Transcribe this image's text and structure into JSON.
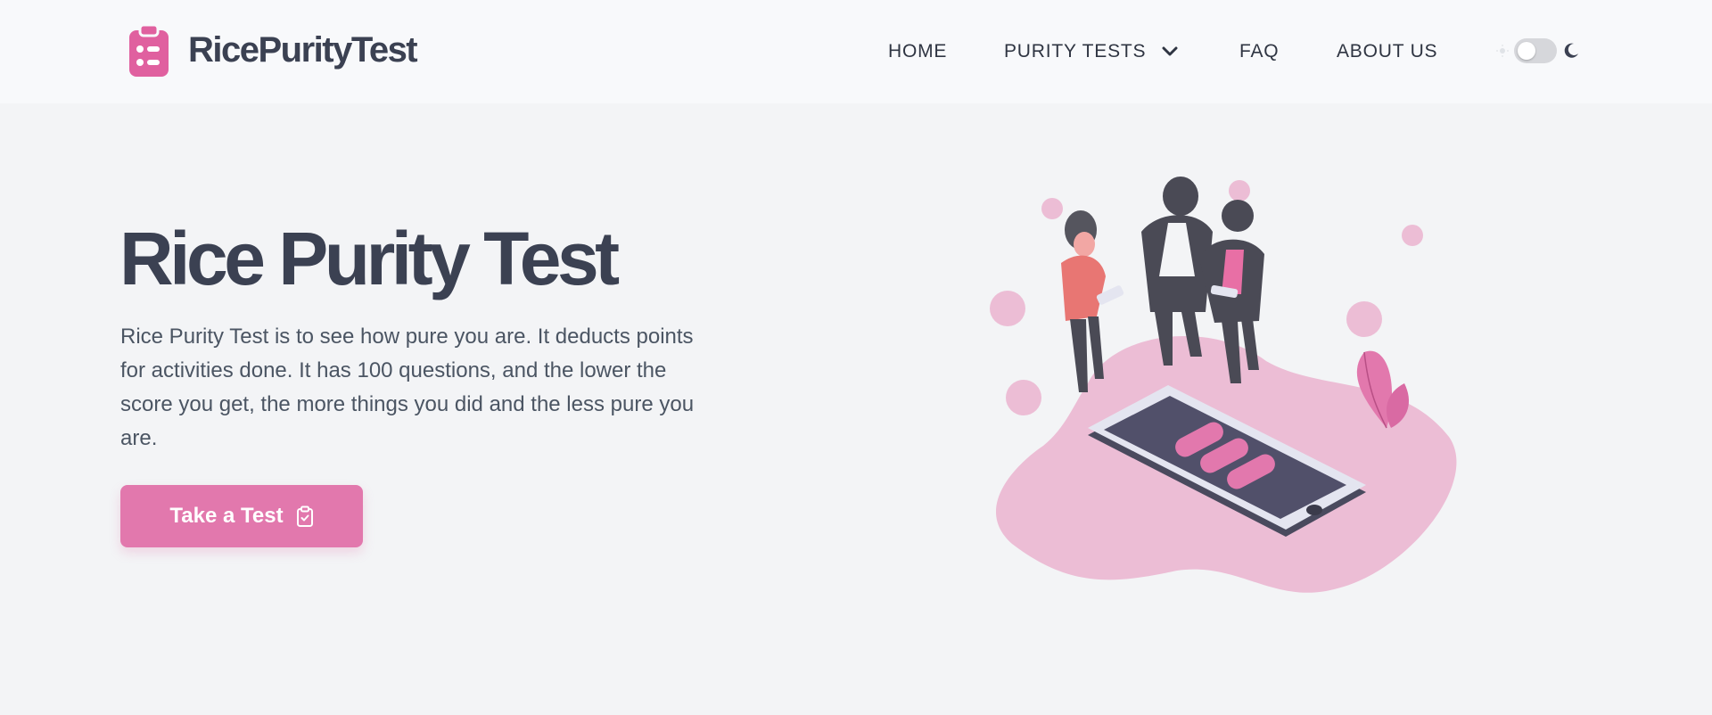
{
  "header": {
    "logo_text": "RicePurityTest",
    "nav": {
      "home": "HOME",
      "purity_tests": "PURITY TESTS",
      "faq": "FAQ",
      "about": "ABOUT US"
    },
    "theme_toggle": {
      "state": "light"
    }
  },
  "hero": {
    "title": "Rice Purity Test",
    "description": "Rice Purity Test is to see how pure you are. It deducts points for activities done. It has 100 questions, and the lower the score you get, the more things you did and the less pure you are.",
    "cta_label": "Take a Test"
  },
  "colors": {
    "accent": "#e278ad",
    "heading": "#3b4152",
    "background": "#f3f4f6",
    "header_bg": "#f8f9fb"
  },
  "icons": {
    "logo": "clipboard-list-icon",
    "dropdown": "chevron-down-icon",
    "sun": "sun-icon",
    "moon": "moon-icon",
    "cta": "clipboard-check-icon"
  }
}
